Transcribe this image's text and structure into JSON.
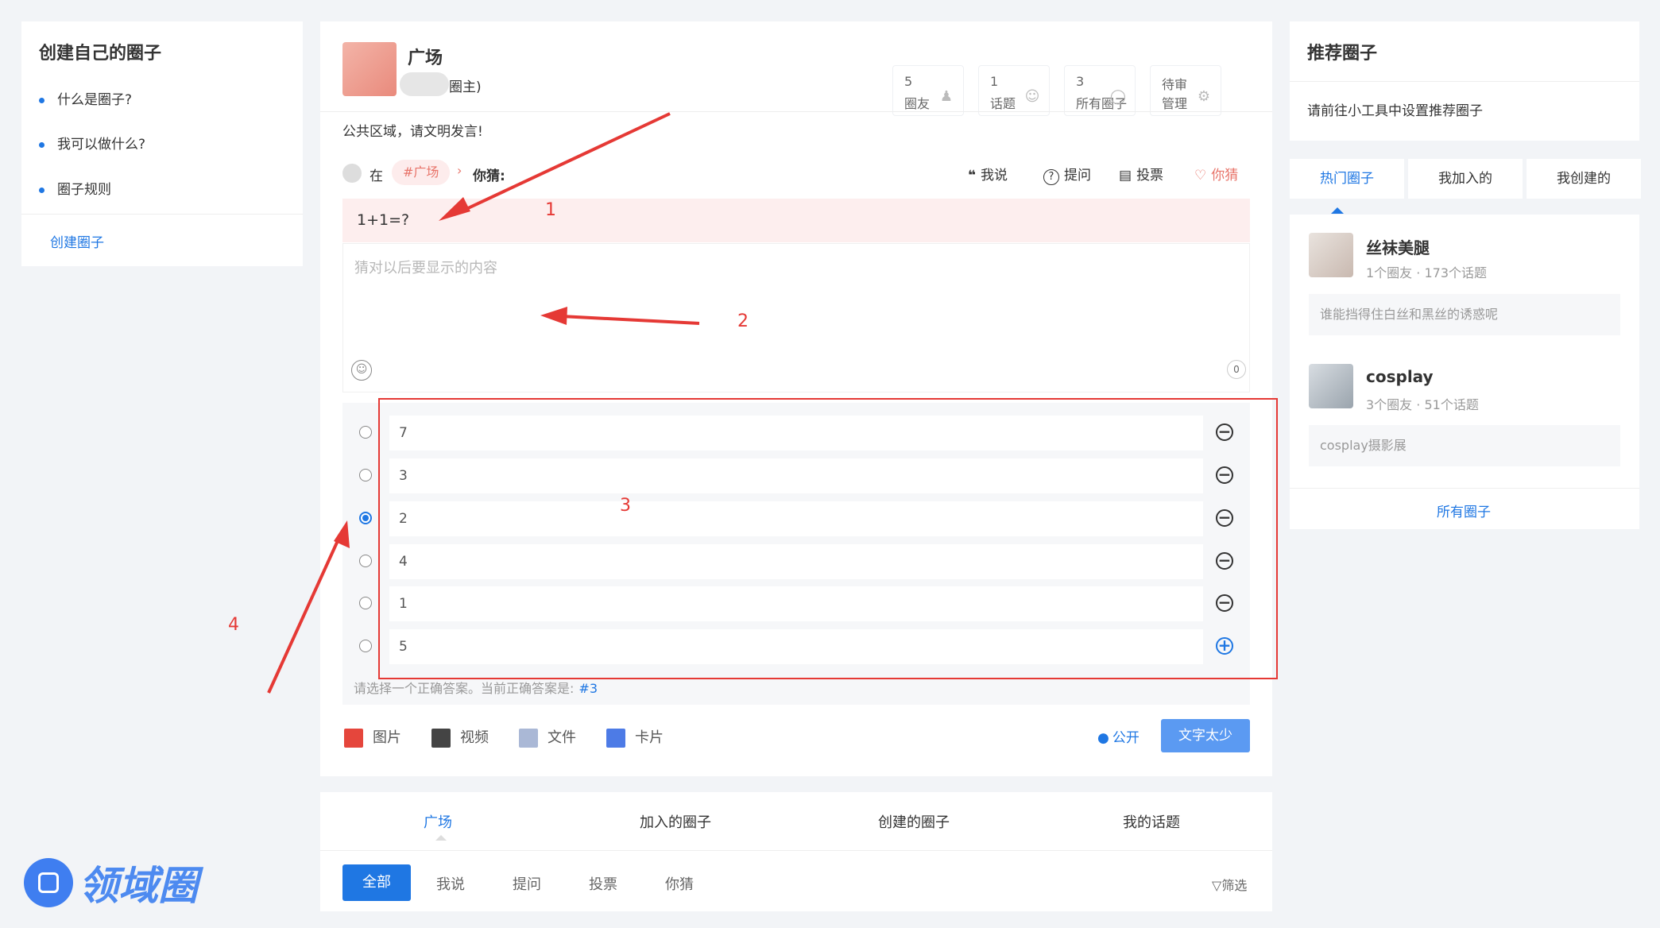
{
  "left_nav": {
    "title": "创建自己的圈子",
    "items": [
      "什么是圈子?",
      "我可以做什么?",
      "圈子规则"
    ],
    "create_link": "创建圈子"
  },
  "circle": {
    "name": "广场",
    "owner_suffix": "圈主)",
    "notice": "公共区域，请文明发言!",
    "stats": [
      {
        "num": "5",
        "label": "圈友",
        "icon": "users-icon"
      },
      {
        "num": "1",
        "label": "话题",
        "icon": "chat-icon"
      },
      {
        "num": "3",
        "label": "所有圈子",
        "icon": "circle-icon"
      },
      {
        "num": "待审",
        "label": "管理",
        "icon": "gear-icon"
      }
    ]
  },
  "composer": {
    "in_label": "在",
    "circle_tag": "#广场",
    "mode_label": "你猜:",
    "types": [
      "我说",
      "提问",
      "投票",
      "你猜"
    ],
    "question_value": "1+1=?",
    "answer_placeholder": "猜对以后要显示的内容",
    "char_count": "0",
    "options": [
      "7",
      "3",
      "2",
      "4",
      "1",
      "5"
    ],
    "selected_index": 2,
    "hint": "请选择一个正确答案。当前正确答案是:",
    "hint_answer": "#3",
    "tools": [
      "图片",
      "视频",
      "文件",
      "卡片"
    ],
    "visibility": "公开",
    "submit": "文字太少"
  },
  "feed_tabs": [
    "广场",
    "加入的圈子",
    "创建的圈子",
    "我的话题"
  ],
  "filter_tabs": [
    "全部",
    "我说",
    "提问",
    "投票",
    "你猜"
  ],
  "filter_btn": "筛选",
  "right": {
    "title": "推荐圈子",
    "hint": "请前往小工具中设置推荐圈子",
    "tabs": [
      "热门圈子",
      "我加入的",
      "我创建的"
    ],
    "circles": [
      {
        "name": "丝袜美腿",
        "members": "1个圈友",
        "topics": "173个话题",
        "desc": "谁能挡得住白丝和黑丝的诱惑呢"
      },
      {
        "name": "cosplay",
        "members": "3个圈友",
        "topics": "51个话题",
        "desc": "cosplay摄影展"
      }
    ],
    "all_link": "所有圈子"
  },
  "annotations": [
    "1",
    "2",
    "3",
    "4"
  ],
  "logo_text": "领域圈",
  "colors": {
    "accent": "#1f77e3",
    "danger": "#e53935",
    "page_bg": "#f2f4f7"
  }
}
